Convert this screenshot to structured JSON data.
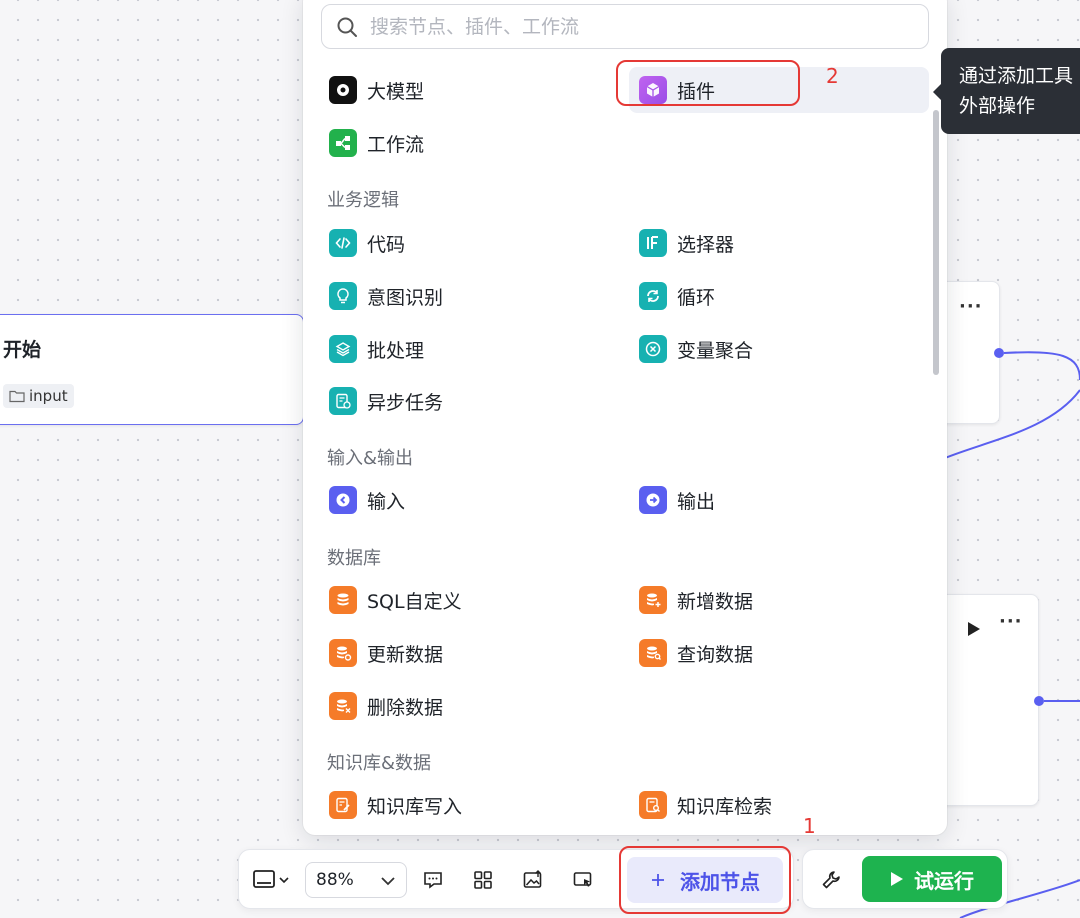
{
  "canvas": {
    "start_node": {
      "title": "开始",
      "output_tag": "input"
    }
  },
  "search": {
    "placeholder": "搜索节点、插件、工作流"
  },
  "top_items": [
    {
      "label": "大模型",
      "icon": "llm-icon"
    },
    {
      "label": "插件",
      "icon": "plugin-cube-icon"
    },
    {
      "label": "工作流",
      "icon": "workflow-icon"
    }
  ],
  "sections": {
    "business_logic": {
      "title": "业务逻辑",
      "items": [
        "代码",
        "选择器",
        "意图识别",
        "循环",
        "批处理",
        "变量聚合",
        "异步任务"
      ]
    },
    "io": {
      "title": "输入&输出",
      "items": [
        "输入",
        "输出"
      ]
    },
    "database": {
      "title": "数据库",
      "items": [
        "SQL自定义",
        "新增数据",
        "更新数据",
        "查询数据",
        "删除数据"
      ]
    },
    "knowledge": {
      "title": "知识库&数据",
      "items": [
        "知识库写入",
        "知识库检索"
      ]
    }
  },
  "tooltip": {
    "line1": "通过添加工具",
    "line2": "外部操作"
  },
  "annotations": {
    "one": "1",
    "two": "2"
  },
  "toolbar": {
    "zoom": "88%",
    "add_node_label": "添加节点",
    "run_label": "试运行"
  },
  "colors": {
    "accent": "#4d53e8",
    "teal": "#17b1b1",
    "orange": "#f57b29",
    "indigo": "#5a5ff0",
    "green": "#1eb34f",
    "red_annotation": "#e53935"
  }
}
